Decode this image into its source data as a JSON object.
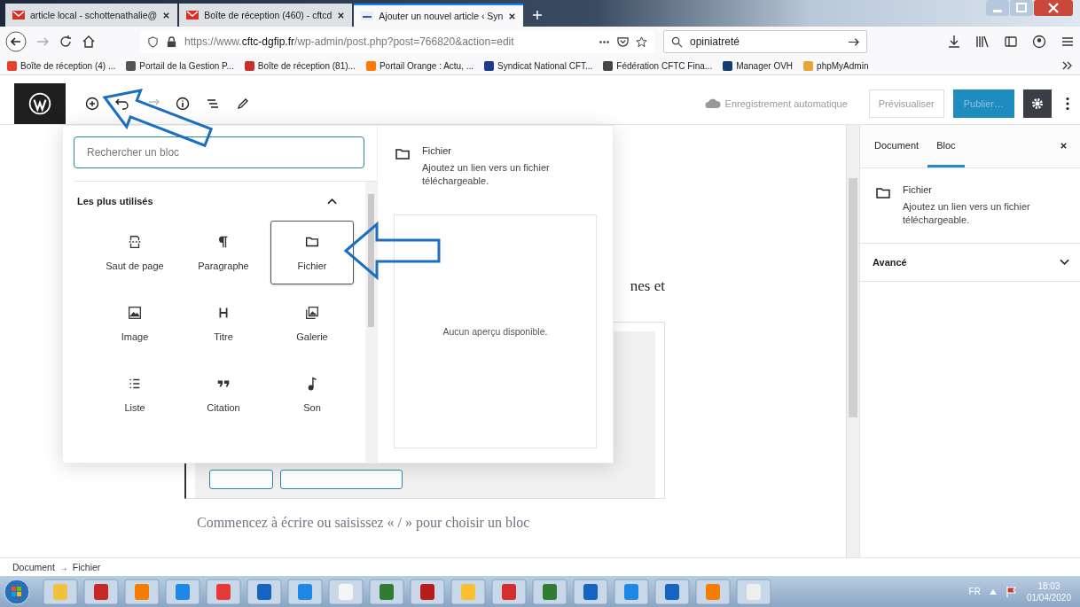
{
  "browser": {
    "tabs": [
      {
        "title": "article local - schottenathalie@",
        "kind": "mail",
        "selected": false
      },
      {
        "title": "Boîte de réception (460) - cftcd",
        "kind": "mail",
        "selected": false
      },
      {
        "title": "Ajouter un nouvel article ‹ Syn",
        "kind": "site",
        "selected": true
      }
    ],
    "url_prefix": "https://www.",
    "url_domain": "cftc-dgfip.fr",
    "url_path": "/wp-admin/post.php?post=766820&action=edit",
    "search": "opiniatreté",
    "bookmarks": [
      {
        "label": "Boîte de réception (4) ...",
        "color": "#e8412c"
      },
      {
        "label": "Portail de la Gestion P...",
        "color": "#555555"
      },
      {
        "label": "Boîte de réception (81)...",
        "color": "#c9302c"
      },
      {
        "label": "Portail Orange : Actu, ...",
        "color": "#ff7900"
      },
      {
        "label": "Syndicat National CFT...",
        "color": "#1a3a8a"
      },
      {
        "label": "Fédération CFTC Fina...",
        "color": "#464646"
      },
      {
        "label": "Manager OVH",
        "color": "#123f6d"
      },
      {
        "label": "phpMyAdmin",
        "color": "#e8a33b"
      }
    ]
  },
  "editor_header": {
    "save_status": "Enregistrement automatique",
    "preview": "Prévisualiser",
    "publish": "Publier…",
    "settings_active": true
  },
  "inserter": {
    "search": {
      "placeholder": "Rechercher un bloc"
    },
    "section": {
      "title": "Les plus utilisés",
      "expanded": true
    },
    "blocks": [
      {
        "label": "Saut de page",
        "kind": "pagebreak",
        "selected": false
      },
      {
        "label": "Paragraphe",
        "kind": "paragraph",
        "selected": false
      },
      {
        "label": "Fichier",
        "kind": "file",
        "selected": true
      },
      {
        "label": "Image",
        "kind": "image",
        "selected": false
      },
      {
        "label": "Titre",
        "kind": "heading",
        "selected": false
      },
      {
        "label": "Galerie",
        "kind": "gallery",
        "selected": false
      },
      {
        "label": "Liste",
        "kind": "list",
        "selected": false
      },
      {
        "label": "Citation",
        "kind": "quote",
        "selected": false
      },
      {
        "label": "Son",
        "kind": "audio",
        "selected": false
      }
    ],
    "preview": {
      "title": "Fichier",
      "description": "Ajoutez un lien vers un fichier téléchargeable.",
      "empty": "Aucun aperçu disponible."
    }
  },
  "content": {
    "partial_text": "nes et",
    "placeholder": "Commencez à écrire ou saisissez « / » pour choisir un bloc"
  },
  "sidebar": {
    "tabs": [
      {
        "label": "Document",
        "selected": false
      },
      {
        "label": "Bloc",
        "selected": true
      }
    ],
    "block": {
      "title": "Fichier",
      "description": "Ajoutez un lien vers un fichier téléchargeable."
    },
    "panels": [
      {
        "title": "Avancé",
        "expanded": false
      }
    ]
  },
  "breadcrumb": {
    "items": [
      "Document",
      "Fichier"
    ],
    "separator": "→"
  },
  "taskbar": {
    "language": "FR",
    "time": "18:03",
    "date": "01/04/2020"
  }
}
